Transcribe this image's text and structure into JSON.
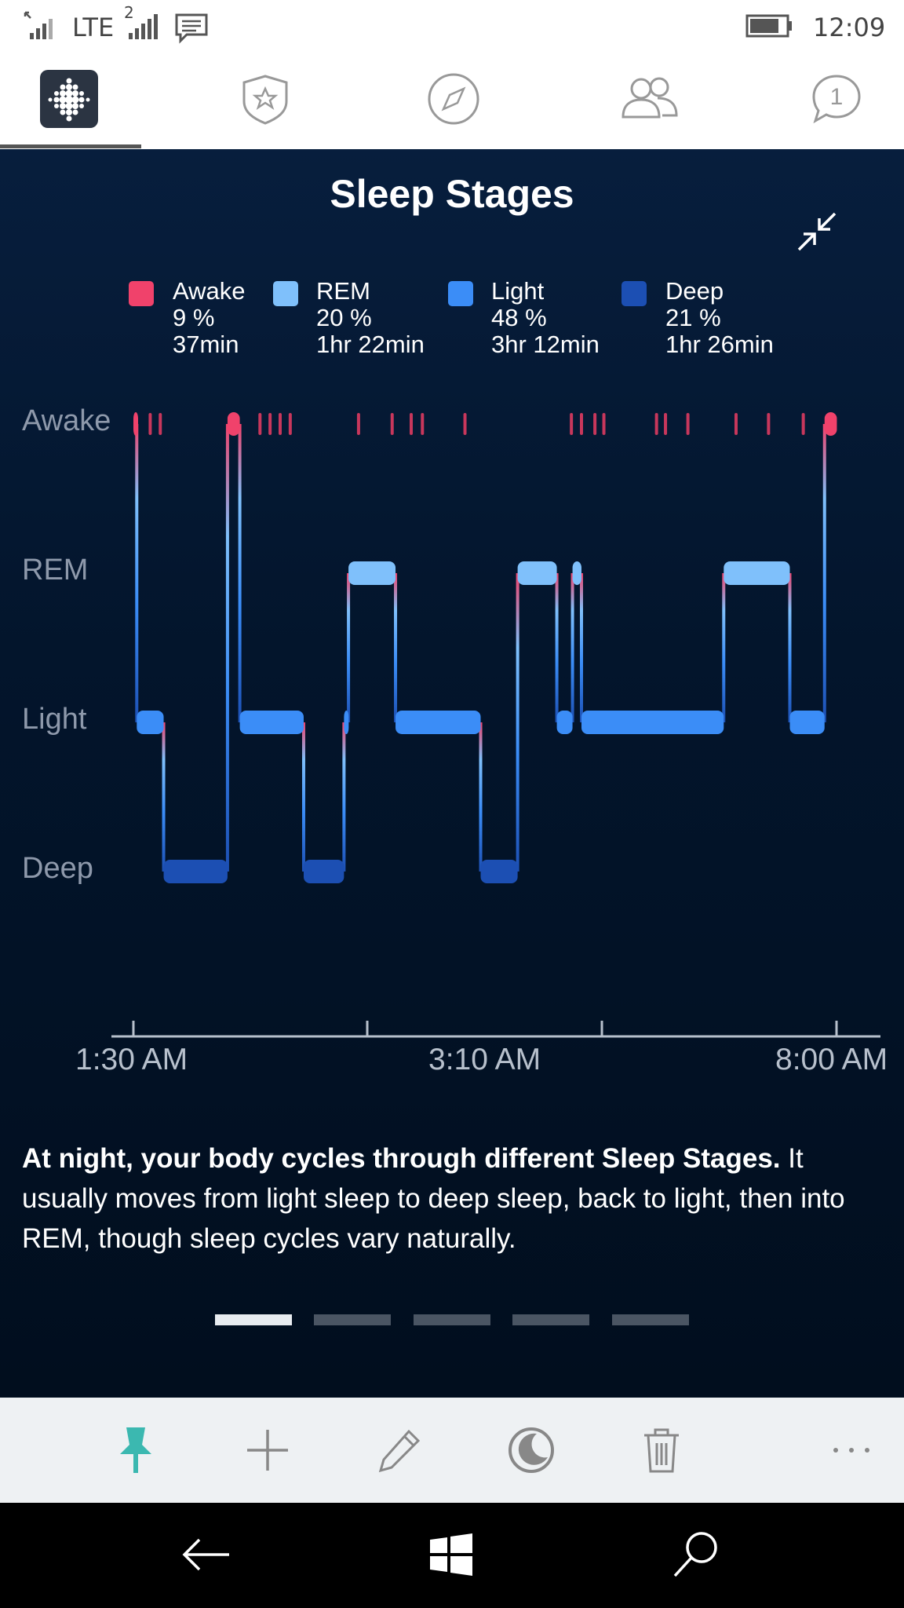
{
  "status_bar": {
    "network": "LTE",
    "sim2_label": "2",
    "time": "12:09"
  },
  "tabs": [
    {
      "name": "dashboard",
      "icon": "fitbit-dots-icon",
      "active": true
    },
    {
      "name": "challenges",
      "icon": "star-badge-icon",
      "active": false
    },
    {
      "name": "discover",
      "icon": "compass-icon",
      "active": false
    },
    {
      "name": "friends",
      "icon": "friends-icon",
      "active": false
    },
    {
      "name": "messages",
      "icon": "chat-icon",
      "badge": "1",
      "active": false
    }
  ],
  "page": {
    "title": "Sleep Stages"
  },
  "legend": [
    {
      "stage": "Awake",
      "percent": "9 %",
      "duration": "37min",
      "color": "#f0426b"
    },
    {
      "stage": "REM",
      "percent": "20 %",
      "duration": "1hr 22min",
      "color": "#7fc0fb"
    },
    {
      "stage": "Light",
      "percent": "48 %",
      "duration": "3hr 12min",
      "color": "#3b8df7"
    },
    {
      "stage": "Deep",
      "percent": "21 %",
      "duration": "1hr 26min",
      "color": "#1c4fb3"
    }
  ],
  "chart_data": {
    "type": "line",
    "y_categories": [
      "Awake",
      "REM",
      "Light",
      "Deep"
    ],
    "x_tick_labels": [
      "1:30 AM",
      "3:10 AM",
      "8:00 AM"
    ],
    "x_range_hours": [
      0,
      6.55
    ],
    "segments": [
      {
        "stage": "Awake",
        "start": 0.0,
        "end": 0.03
      },
      {
        "stage": "Light",
        "start": 0.03,
        "end": 0.27
      },
      {
        "stage": "Deep",
        "start": 0.27,
        "end": 0.84
      },
      {
        "stage": "Awake",
        "start": 0.84,
        "end": 0.95
      },
      {
        "stage": "Light",
        "start": 0.95,
        "end": 1.52
      },
      {
        "stage": "Deep",
        "start": 1.52,
        "end": 1.88
      },
      {
        "stage": "Light",
        "start": 1.88,
        "end": 1.92
      },
      {
        "stage": "REM",
        "start": 1.92,
        "end": 2.34
      },
      {
        "stage": "Light",
        "start": 2.34,
        "end": 3.1
      },
      {
        "stage": "Deep",
        "start": 3.1,
        "end": 3.43
      },
      {
        "stage": "REM",
        "start": 3.43,
        "end": 3.78
      },
      {
        "stage": "Light",
        "start": 3.78,
        "end": 3.92
      },
      {
        "stage": "REM",
        "start": 3.92,
        "end": 4.0
      },
      {
        "stage": "Light",
        "start": 4.0,
        "end": 5.27
      },
      {
        "stage": "REM",
        "start": 5.27,
        "end": 5.86
      },
      {
        "stage": "Light",
        "start": 5.86,
        "end": 6.17
      },
      {
        "stage": "Awake",
        "start": 6.17,
        "end": 6.28
      }
    ],
    "awake_ticks": [
      0.15,
      0.24,
      1.13,
      1.22,
      1.31,
      1.4,
      2.01,
      2.31,
      2.48,
      2.58,
      2.96,
      3.91,
      4.0,
      4.12,
      4.2,
      4.67,
      4.75,
      4.95,
      5.38,
      5.67,
      5.98
    ],
    "colors": {
      "awake": "#f0426b",
      "rem": "#7fc0fb",
      "light": "#3b8df7",
      "deep": "#1c4fb3"
    }
  },
  "description": {
    "bold": "At night, your body cycles through different Sleep Stages.",
    "rest": " It usually moves from light sleep to deep sleep, back to light, then into REM, though sleep cycles vary naturally."
  },
  "pager": {
    "count": 5,
    "active_index": 0
  },
  "app_bar": [
    {
      "name": "pin",
      "icon": "pin-icon",
      "color": "#3bb8b0"
    },
    {
      "name": "add",
      "icon": "plus-icon"
    },
    {
      "name": "edit",
      "icon": "pencil-icon"
    },
    {
      "name": "theme",
      "icon": "moon-icon"
    },
    {
      "name": "delete",
      "icon": "trash-icon"
    },
    {
      "name": "more",
      "icon": "ellipsis-icon"
    }
  ],
  "nav_bar": [
    {
      "name": "back",
      "icon": "back-arrow-icon"
    },
    {
      "name": "start",
      "icon": "windows-logo-icon"
    },
    {
      "name": "search",
      "icon": "search-icon"
    }
  ]
}
